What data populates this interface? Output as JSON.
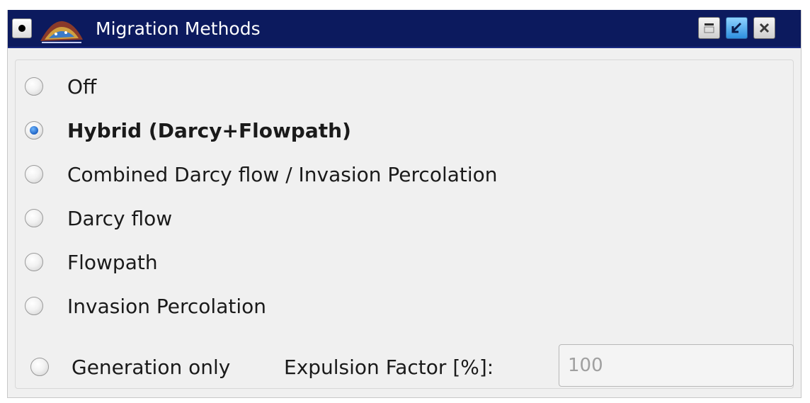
{
  "window": {
    "title": "Migration Methods"
  },
  "icons": {
    "system_menu": "system-menu-icon",
    "app": "migration-app-icon",
    "minimize": "minimize-icon",
    "restore": "restore-icon",
    "close": "close-icon"
  },
  "options": [
    {
      "label": "Off",
      "checked": false
    },
    {
      "label": "Hybrid (Darcy+Flowpath)",
      "checked": true
    },
    {
      "label": "Combined Darcy flow / Invasion Percolation",
      "checked": false
    },
    {
      "label": "Darcy flow",
      "checked": false
    },
    {
      "label": "Flowpath",
      "checked": false
    },
    {
      "label": "Invasion Percolation",
      "checked": false
    },
    {
      "label": "Generation only",
      "checked": false
    }
  ],
  "expulsion": {
    "label": "Expulsion Factor [%]:",
    "value": "100"
  },
  "colors": {
    "titlebar": "#0c1a5e",
    "background": "#f0f0f0",
    "accent": "#1f63c4"
  }
}
